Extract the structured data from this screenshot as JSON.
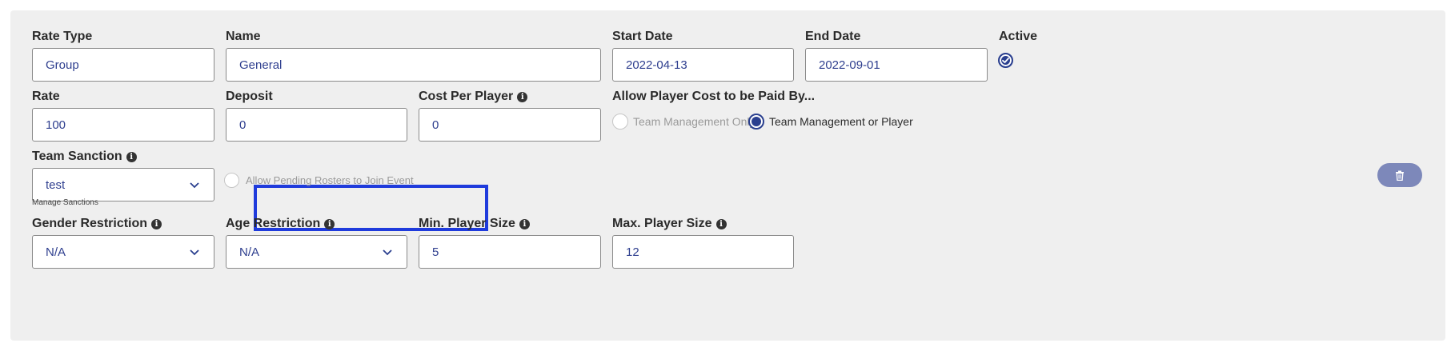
{
  "labels": {
    "rate_type": "Rate Type",
    "name": "Name",
    "start_date": "Start Date",
    "end_date": "End Date",
    "active": "Active",
    "rate": "Rate",
    "deposit": "Deposit",
    "cost_per_player": "Cost Per Player",
    "allow_player_cost": "Allow Player Cost to be Paid By...",
    "team_sanction": "Team Sanction",
    "gender_restriction": "Gender Restriction",
    "age_restriction": "Age Restriction",
    "min_player_size": "Min. Player Size",
    "max_player_size": "Max. Player Size"
  },
  "values": {
    "rate_type": "Group",
    "name": "General",
    "start_date": "2022-04-13",
    "end_date": "2022-09-01",
    "rate": "100",
    "deposit": "0",
    "cost_per_player": "0",
    "team_sanction": "test",
    "gender_restriction": "N/A",
    "age_restriction": "N/A",
    "min_player_size": "5",
    "max_player_size": "12"
  },
  "active_checked": true,
  "pay_options": {
    "selected": "Team Management or Player",
    "options": [
      "Team Management Only",
      "Team Management or Player"
    ]
  },
  "manage_sanctions_link": "Manage Sanctions",
  "pending_rosters": {
    "label": "Allow Pending Rosters to Join Event",
    "checked": false
  },
  "icons": {
    "info": "info-icon",
    "chevron": "chevron-down-icon",
    "delete": "trash-icon",
    "check": "check-circle-icon"
  },
  "colors": {
    "accent": "#2a3f8f",
    "value_text": "#2f3f8f",
    "highlight": "#1f3bdc",
    "delete_button": "#7d88ba"
  }
}
